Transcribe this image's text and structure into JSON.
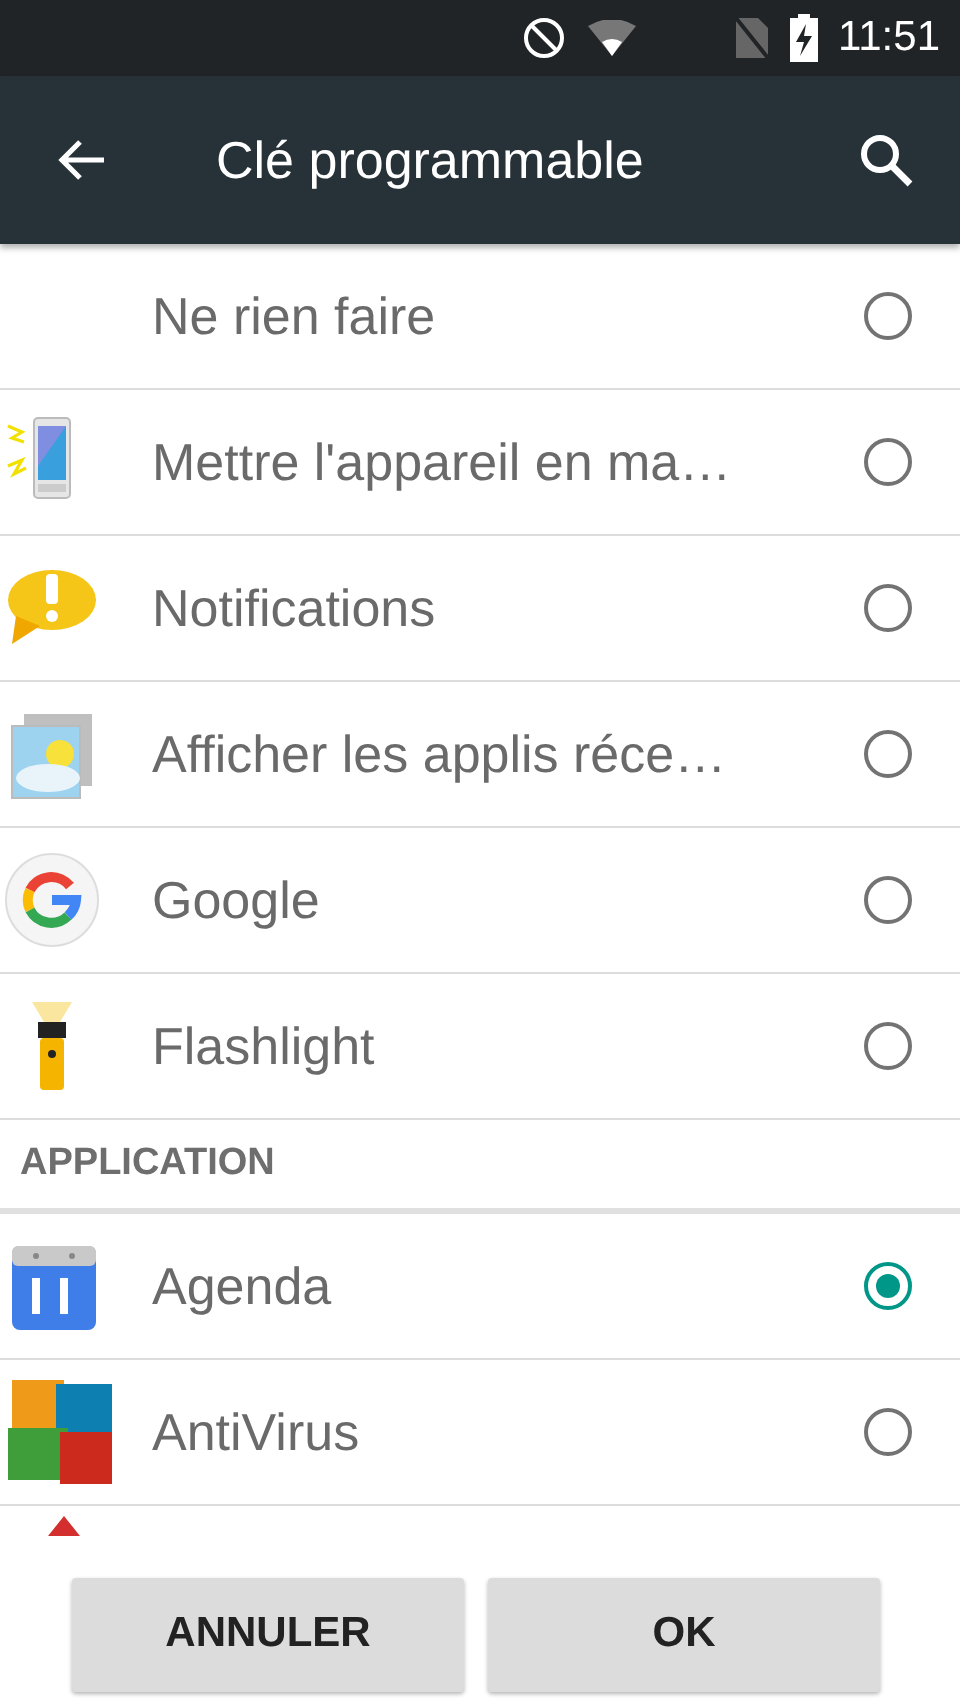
{
  "status_bar": {
    "time": "11:51"
  },
  "app_bar": {
    "title": "Clé programmable"
  },
  "actions": [
    {
      "label": "Ne rien faire",
      "selected": false
    },
    {
      "label": "Mettre l'appareil en ma…",
      "selected": false
    },
    {
      "label": "Notifications",
      "selected": false
    },
    {
      "label": "Afficher les applis réce…",
      "selected": false
    },
    {
      "label": "Google",
      "selected": false
    },
    {
      "label": "Flashlight",
      "selected": false
    }
  ],
  "section": {
    "title": "APPLICATION"
  },
  "apps": [
    {
      "label": "Agenda",
      "selected": true
    },
    {
      "label": "AntiVirus",
      "selected": false
    }
  ],
  "buttons": [
    {
      "label": "ANNULER"
    },
    {
      "label": "OK"
    }
  ]
}
